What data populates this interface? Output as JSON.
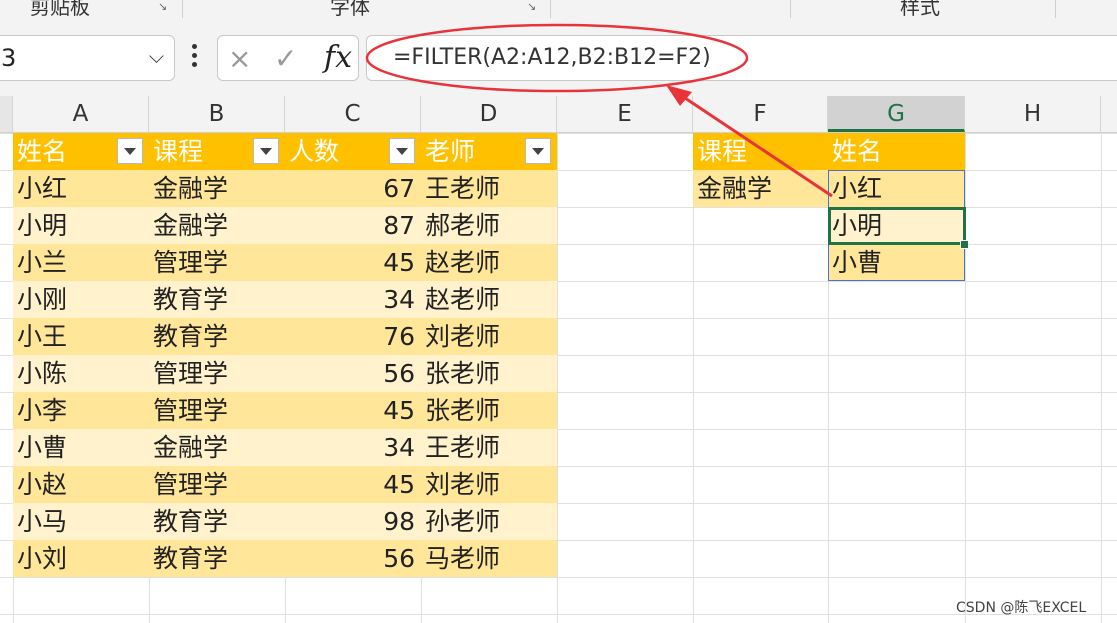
{
  "ribbon": {
    "groups": [
      "剪贴板",
      "字体",
      "样式"
    ]
  },
  "formula_bar": {
    "name_box": "3",
    "cancel_icon": "×",
    "enter_icon": "✓",
    "fx_label": "fx",
    "formula": "=FILTER(A2:A12,B2:B12=F2)"
  },
  "columns": [
    "A",
    "B",
    "C",
    "D",
    "E",
    "F",
    "G",
    "H"
  ],
  "active_column": "G",
  "table": {
    "headers": [
      "姓名",
      "课程",
      "人数",
      "老师"
    ],
    "rows": [
      [
        "小红",
        "金融学",
        "67",
        "王老师"
      ],
      [
        "小明",
        "金融学",
        "87",
        "郝老师"
      ],
      [
        "小兰",
        "管理学",
        "45",
        "赵老师"
      ],
      [
        "小刚",
        "教育学",
        "34",
        "赵老师"
      ],
      [
        "小王",
        "教育学",
        "76",
        "刘老师"
      ],
      [
        "小陈",
        "管理学",
        "56",
        "张老师"
      ],
      [
        "小李",
        "管理学",
        "45",
        "张老师"
      ],
      [
        "小曹",
        "金融学",
        "34",
        "王老师"
      ],
      [
        "小赵",
        "管理学",
        "45",
        "刘老师"
      ],
      [
        "小马",
        "教育学",
        "98",
        "孙老师"
      ],
      [
        "小刘",
        "教育学",
        "56",
        "马老师"
      ]
    ]
  },
  "criteria": {
    "header": "课程",
    "value": "金融学"
  },
  "result": {
    "header": "姓名",
    "values": [
      "小红",
      "小明",
      "小曹"
    ]
  },
  "annotation": {
    "color": "#e8333a"
  },
  "watermark": "CSDN @陈飞EXCEL",
  "colors": {
    "table_header": "#ffc000",
    "band_dark": "#ffe699",
    "band_light": "#fff2cc",
    "excel_green": "#217346"
  }
}
